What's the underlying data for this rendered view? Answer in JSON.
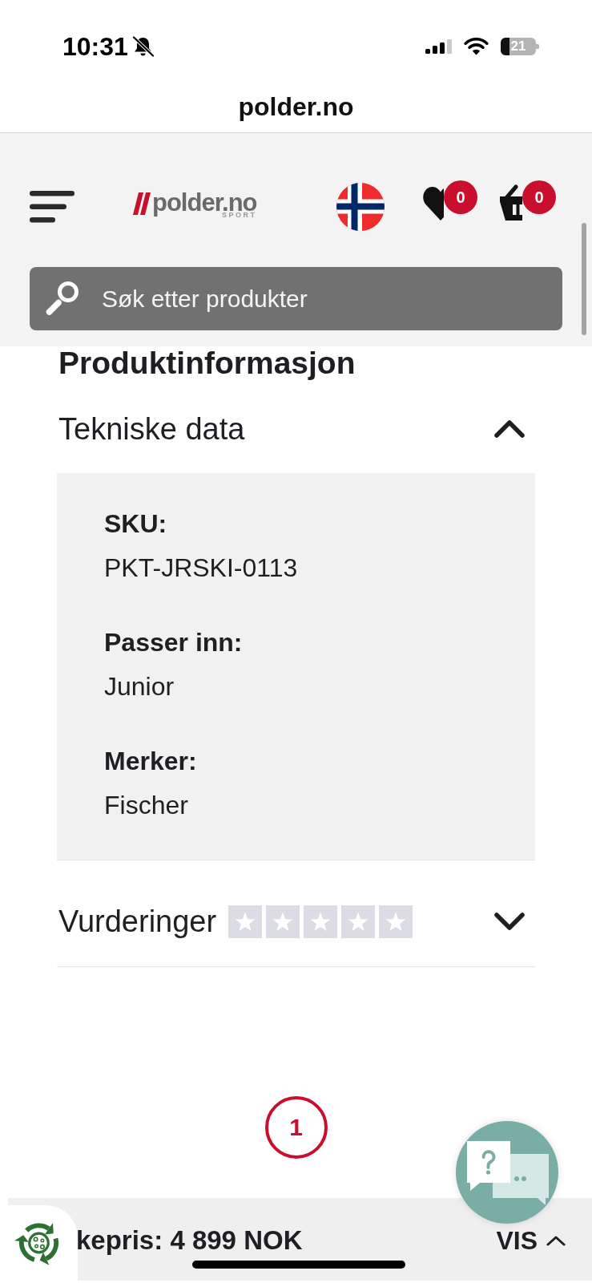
{
  "status_bar": {
    "time": "10:31",
    "battery": "21"
  },
  "address_bar": {
    "url": "polder.no"
  },
  "header": {
    "logo": {
      "wordmark": "polder.no",
      "tagline": "SPORT"
    },
    "wishlist": {
      "count": "0"
    },
    "cart": {
      "count": "0"
    },
    "search": {
      "placeholder": "Søk etter produkter"
    }
  },
  "product_info": {
    "title": "Produktinformasjon",
    "sections": [
      {
        "kind": "specs",
        "title": "Tekniske data",
        "expanded": true,
        "specs": [
          {
            "label": "SKU:",
            "value": "PKT-JRSKI-0113"
          },
          {
            "label": "Passer inn:",
            "value": "Junior"
          },
          {
            "label": "Merker:",
            "value": "Fischer"
          }
        ]
      },
      {
        "kind": "rating",
        "title": "Vurderinger",
        "expanded": false,
        "stars": 0
      }
    ]
  },
  "step": {
    "number": "1"
  },
  "price_bar": {
    "price": "kepris: 4 899 NOK",
    "toggle": "VIS"
  }
}
